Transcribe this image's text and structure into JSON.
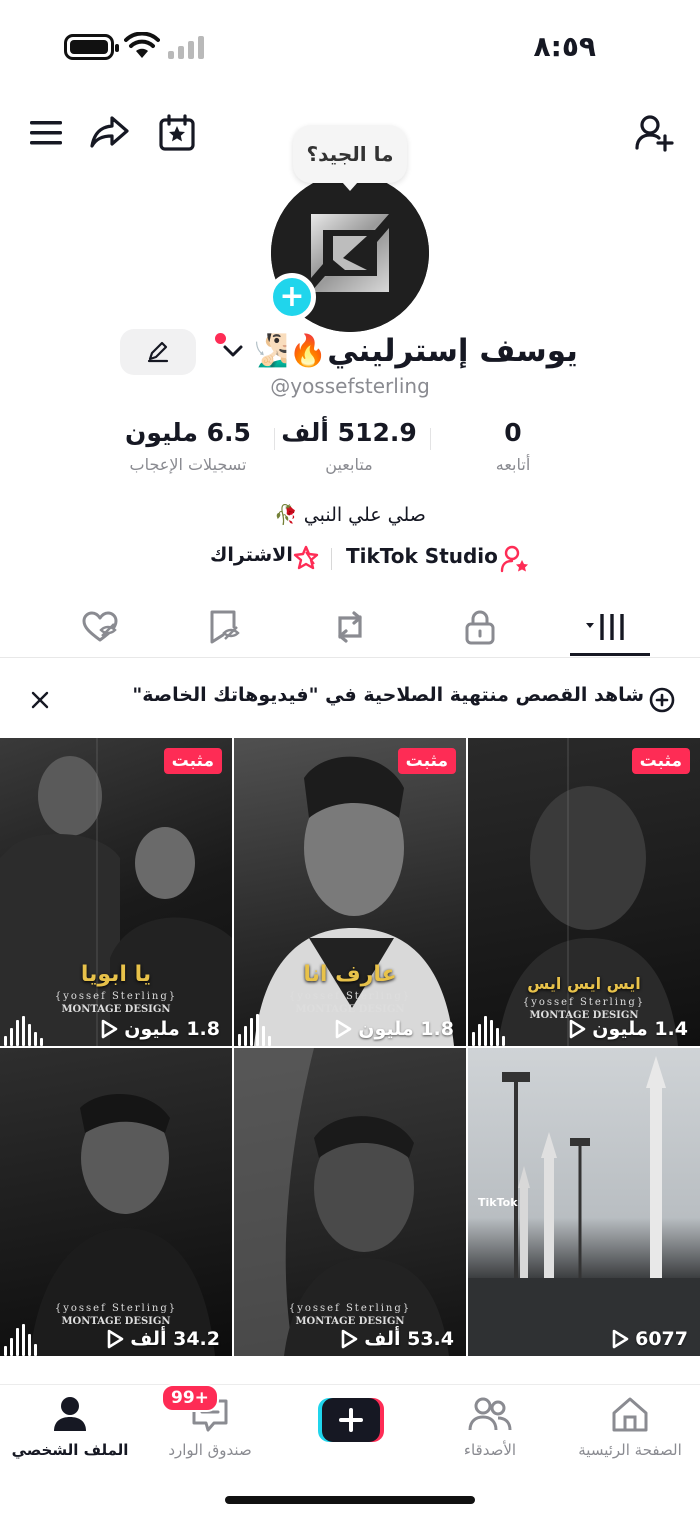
{
  "status_bar": {
    "time": "٨:٥٩"
  },
  "profile": {
    "bubble_text": "ما الجيد؟",
    "display_name": "يوسف إسترليني🔥🧏🏻‍♂️",
    "username": "@yossefsterling",
    "bio": "صلي علي النبي 🥀"
  },
  "stats": [
    {
      "value": "6.5 مليون",
      "label": "تسجيلات الإعجاب"
    },
    {
      "value": "512.9 ألف",
      "label": "متابعين"
    },
    {
      "value": "0",
      "label": "أتابعه"
    }
  ],
  "links": {
    "subscribe": "الاشتراك",
    "studio": "TikTok Studio"
  },
  "tabs": [
    "liked-hidden",
    "favorites",
    "reposts",
    "private",
    "videos"
  ],
  "banner": {
    "text": "شاهد القصص منتهية الصلاحية في \"فيديوهاتك الخاصة\""
  },
  "videos": [
    {
      "pinned": "مثبت",
      "views": "1.8 مليون",
      "caption": "يا ابويا",
      "watermark_top": "{yossef Sterling}",
      "watermark_bottom": "MONTAGE DESIGN"
    },
    {
      "pinned": "مثبت",
      "views": "1.8 مليون",
      "caption": "عارف انا",
      "watermark_top": "{yossef Sterling}",
      "watermark_bottom": "MONTAGE DESIGN"
    },
    {
      "pinned": "مثبت",
      "views": "1.4 مليون",
      "caption": "ايس ايس ايس",
      "watermark_top": "{yossef Sterling}",
      "watermark_bottom": "MONTAGE DESIGN"
    },
    {
      "views": "34.2 ألف",
      "watermark_top": "{yossef Sterling}",
      "watermark_bottom": "MONTAGE DESIGN"
    },
    {
      "views": "53.4 ألف",
      "watermark_top": "{yossef Sterling}",
      "watermark_bottom": "MONTAGE DESIGN"
    },
    {
      "views": "6077",
      "tiktok_mark": "TikTok"
    }
  ],
  "bottom_nav": {
    "home": "الصفحة الرئيسية",
    "friends": "الأصدقاء",
    "inbox": "صندوق الوارد",
    "inbox_badge": "99+",
    "profile": "الملف الشخصي"
  },
  "colors": {
    "accent": "#fe2c55",
    "cyan": "#20d5ec",
    "text": "#161823",
    "muted": "#8a8b91"
  }
}
